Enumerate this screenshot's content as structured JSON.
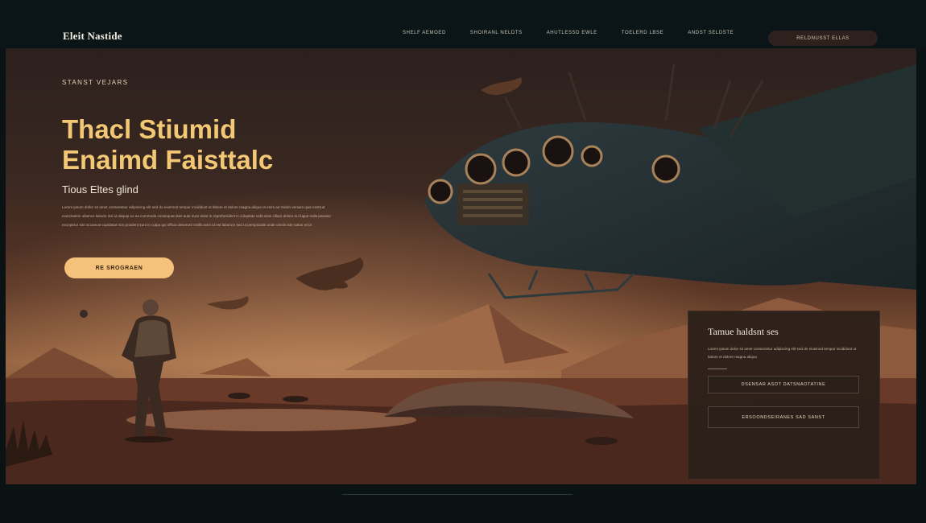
{
  "header": {
    "brand": "Eleit Nastide",
    "nav": [
      "Shelf Aemoed",
      "Shoiranl Neldts",
      "Ahutlessd Ewle",
      "Toelerd Lbse",
      "Andst Seldste"
    ],
    "cta_label": "Reldnusst Ellas"
  },
  "hero": {
    "eyebrow": "Stanst Vejars",
    "headline_line1": "Thacl Stiumid",
    "headline_line2": "Enaimd Faisttalc",
    "subheading": "Tious Eltes glind",
    "paragraph": "Lorem ipsum dollor sit amet conseetetur adipiscing elit sed do eiusmod tempor incididunt ut labore et dolore magna aliqua ut enim ad minim veniam quis nostrud exercitation ullamco laboris nisi ut aliquip ex ea commodo consequat duis aute irure dolor in reprehenderit in voluptate velit esse cillum dolore eu fugiat nulla pariatur excepteur sint occaecat cupidatat non proident sunt in culpa qui officia deserunt mollit anim id est laborum sed ut perspiciatis unde omnis iste natus error",
    "cta_label": "Re Srograen"
  },
  "card": {
    "title": "Tamue haldsnt ses",
    "text": "Lorem ipsum dolor sit amet consectetur adipiscing elit sed do eiusmod tempor incididunt ut labore et dolore magna aliqua",
    "button1": "Dsensar asot Datsnaotatine",
    "button2": "Ersoondseiranes sad sanst"
  },
  "colors": {
    "accent": "#f4c27a",
    "headline": "#f2c874",
    "background": "#0a1214",
    "card_bg": "#2c201a"
  }
}
